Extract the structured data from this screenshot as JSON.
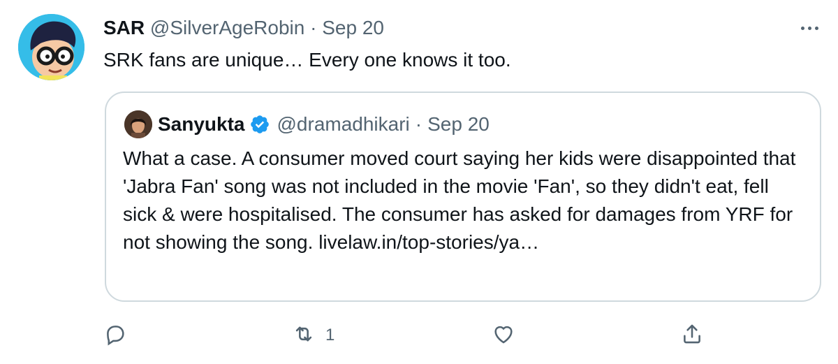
{
  "tweet": {
    "author_name": "SAR",
    "handle": "@SilverAgeRobin",
    "separator": "·",
    "date": "Sep 20",
    "text": "SRK fans are unique… Every one knows it too."
  },
  "quoted_tweet": {
    "author_name": "Sanyukta",
    "verified": true,
    "handle": "@dramadhikari",
    "separator": "·",
    "date": "Sep 20",
    "text": "What a case. A consumer moved court saying her kids were disappointed that 'Jabra Fan' song was not included in the movie 'Fan', so they didn't eat, fell sick & were hospitalised. The consumer has asked for damages from YRF for not showing the song.  livelaw.in/top-stories/ya…"
  },
  "actions": {
    "reply_count": "",
    "retweet_count": "1",
    "like_count": "",
    "icons": [
      "reply-icon",
      "retweet-icon",
      "like-icon",
      "share-icon"
    ]
  },
  "colors": {
    "text": "#0f1419",
    "secondary": "#536471",
    "border": "#cfd9de",
    "verified": "#1d9bf0"
  }
}
